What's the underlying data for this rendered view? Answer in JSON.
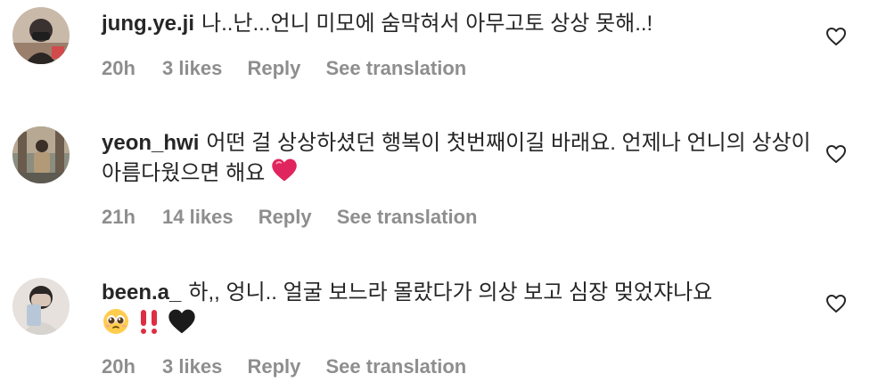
{
  "comments": [
    {
      "username": "jung.ye.ji",
      "text": "나..난...언니 미모에 숨막혀서 아무고토 상상 못해..!",
      "emojis": [],
      "time": "20h",
      "likes": "3 likes",
      "reply": "Reply",
      "translate": "See translation"
    },
    {
      "username": "yeon_hwi",
      "text": "어떤 걸 상상하셨던 행복이 첫번째이길 바래요. 언제나 언니의 상상이 아름다웠으면 해요",
      "emojis": [
        "red-heart"
      ],
      "time": "21h",
      "likes": "14 likes",
      "reply": "Reply",
      "translate": "See translation"
    },
    {
      "username": "been.a_",
      "text": "하,, 엉니.. 얼굴 보느라 몰랐다가 의상 보고 심장 멎었쟈나요",
      "emojis": [
        "pleading-face",
        "double-exclamation",
        "black-heart"
      ],
      "time": "20h",
      "likes": "3 likes",
      "reply": "Reply",
      "translate": "See translation"
    }
  ],
  "colors": {
    "text": "#262626",
    "secondary": "#8e8e8e",
    "red_heart": "#e0245e"
  }
}
